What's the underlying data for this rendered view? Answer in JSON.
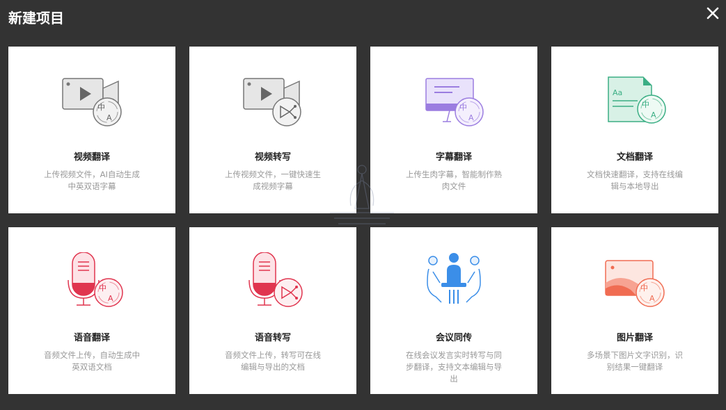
{
  "header": {
    "title": "新建项目"
  },
  "cards": [
    {
      "name": "视频翻译",
      "desc": "上传视频文件，AI自动生成中英双语字幕",
      "icon": "video-translate-icon"
    },
    {
      "name": "视频转写",
      "desc": "上传视频文件，一键快速生成视频字幕",
      "icon": "video-transcribe-icon"
    },
    {
      "name": "字幕翻译",
      "desc": "上传生肉字幕，智能制作熟肉文件",
      "icon": "subtitle-translate-icon"
    },
    {
      "name": "文档翻译",
      "desc": "文档快速翻译，支持在线编辑与本地导出",
      "icon": "document-translate-icon"
    },
    {
      "name": "语音翻译",
      "desc": "音频文件上传，自动生成中英双语文档",
      "icon": "voice-translate-icon"
    },
    {
      "name": "语音转写",
      "desc": "音频文件上传，转写可在线编辑与导出的文档",
      "icon": "voice-transcribe-icon"
    },
    {
      "name": "会议同传",
      "desc": "在线会议发言实时转写与同步翻译，支持文本编辑与导出",
      "icon": "meeting-interpret-icon"
    },
    {
      "name": "图片翻译",
      "desc": "多场景下图片文字识别，识别结果一键翻译",
      "icon": "image-translate-icon"
    }
  ],
  "colors": {
    "background": "#333333",
    "card": "#ffffff",
    "video": "#777777",
    "subtitle": "#9b7de0",
    "document": "#3aae84",
    "voice": "#e0354f",
    "meeting": "#3b8ee8",
    "image": "#f06c52"
  }
}
